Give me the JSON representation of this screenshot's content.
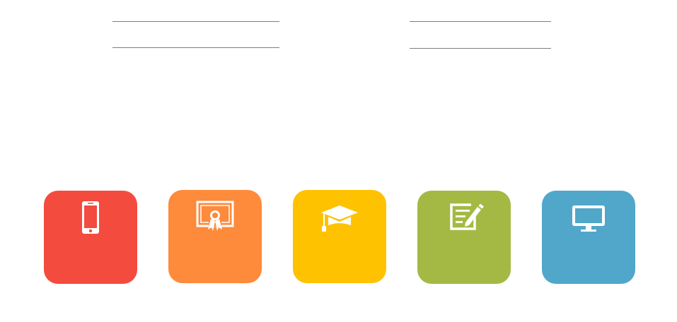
{
  "colors": {
    "divider": "#7d7d7d",
    "background": "#ffffff"
  },
  "tiles": [
    {
      "icon": "smartphone-icon",
      "color": "#f44b3f",
      "label": ""
    },
    {
      "icon": "certificate-icon",
      "color": "#fe8a3c",
      "label": ""
    },
    {
      "icon": "graduation-cap-icon",
      "color": "#fec201",
      "label": ""
    },
    {
      "icon": "edit-document-icon",
      "color": "#a4b944",
      "label": ""
    },
    {
      "icon": "desktop-monitor-icon",
      "color": "#50a7ca",
      "label": ""
    }
  ]
}
